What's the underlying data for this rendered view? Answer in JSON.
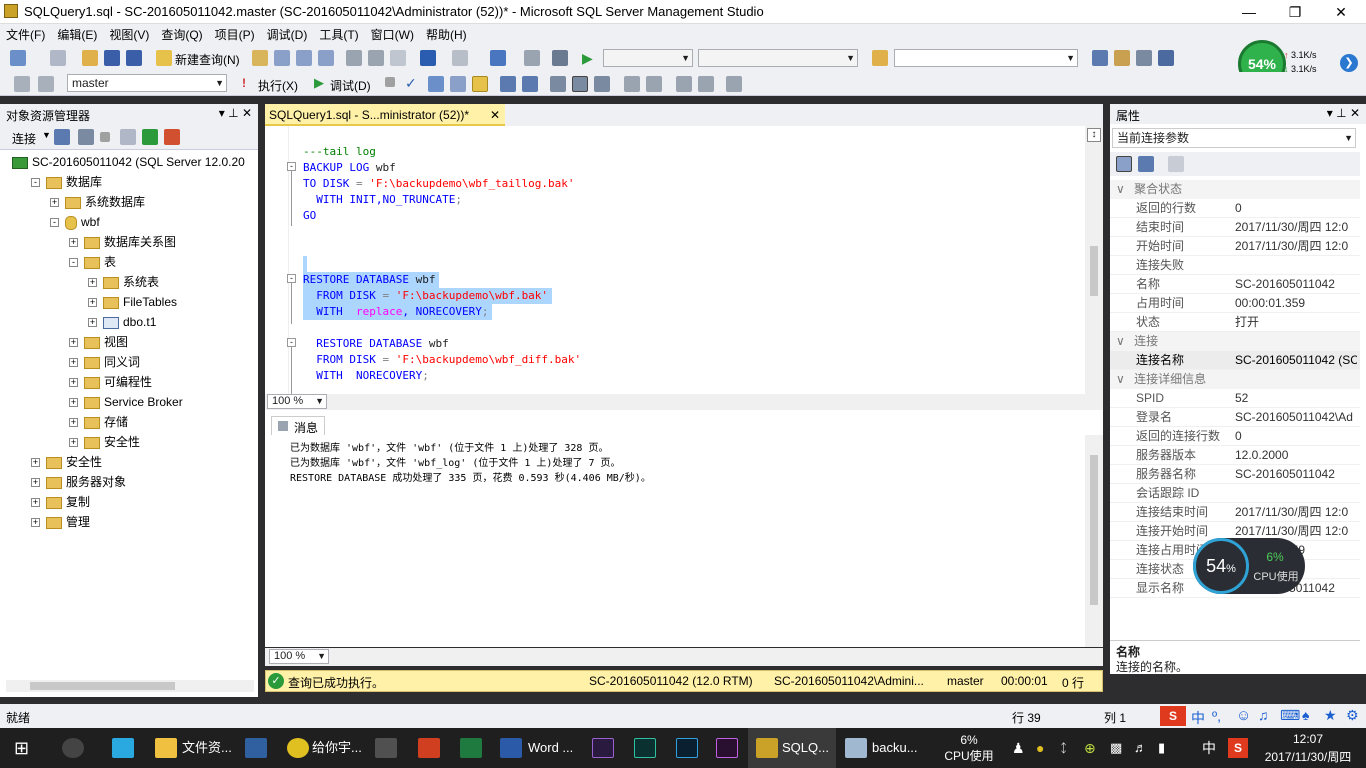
{
  "title": "SQLQuery1.sql - SC-201605011042.master (SC-201605011042\\Administrator (52))* - Microsoft SQL Server Management Studio",
  "menu": [
    "文件(F)",
    "编辑(E)",
    "视图(V)",
    "查询(Q)",
    "项目(P)",
    "调试(D)",
    "工具(T)",
    "窗口(W)",
    "帮助(H)"
  ],
  "toolbar": {
    "new_query": "新建查询(N)",
    "database": "master",
    "execute": "执行(X)",
    "debug": "调试(D)"
  },
  "gauge": {
    "percent": "54%",
    "up": "3.1K/s",
    "down": "3.1K/s"
  },
  "object_explorer": {
    "title": "对象资源管理器",
    "connect": "连接",
    "nodes": [
      {
        "label": "SC-201605011042 (SQL Server 12.0.20",
        "indent": 0
      },
      {
        "label": "数据库",
        "indent": 1
      },
      {
        "label": "系统数据库",
        "indent": 2
      },
      {
        "label": "wbf",
        "indent": 2
      },
      {
        "label": "数据库关系图",
        "indent": 3
      },
      {
        "label": "表",
        "indent": 3
      },
      {
        "label": "系统表",
        "indent": 4
      },
      {
        "label": "FileTables",
        "indent": 4
      },
      {
        "label": "dbo.t1",
        "indent": 4
      },
      {
        "label": "视图",
        "indent": 3
      },
      {
        "label": "同义词",
        "indent": 3
      },
      {
        "label": "可编程性",
        "indent": 3
      },
      {
        "label": "Service Broker",
        "indent": 3
      },
      {
        "label": "存储",
        "indent": 3
      },
      {
        "label": "安全性",
        "indent": 3
      },
      {
        "label": "安全性",
        "indent": 1
      },
      {
        "label": "服务器对象",
        "indent": 1
      },
      {
        "label": "复制",
        "indent": 1
      },
      {
        "label": "管理",
        "indent": 1
      }
    ]
  },
  "editor": {
    "tab": "SQLQuery1.sql - S...ministrator (52))*",
    "zoom": "100 %",
    "code": {
      "l1": "---tail log",
      "l2a": "BACKUP LOG",
      "l2b": " wbf",
      "l3a": "TO DISK",
      "l3b": " = ",
      "l3c": "'F:\\backupdemo\\wbf_taillog.bak'",
      "l4a": "  WITH INIT,NO_TRUNCATE",
      "l4b": ";",
      "l5": "GO",
      "l6a": "RESTORE DATABASE",
      "l6b": " wbf",
      "l7a": "  FROM DISK",
      "l7b": " = ",
      "l7c": "'F:\\backupdemo\\wbf.bak'",
      "l8a": "  WITH  ",
      "l8b": "replace",
      "l8c": ", NORECOVERY",
      "l8d": ";",
      "l9a": "  RESTORE DATABASE",
      "l9b": " wbf",
      "l10a": "  FROM DISK",
      "l10b": " = ",
      "l10c": "'F:\\backupdemo\\wbf_diff.bak'",
      "l11a": "  WITH  NORECOVERY",
      "l11b": ";"
    }
  },
  "messages": {
    "tab": "消息",
    "lines": [
      "已为数据库 'wbf'，文件 'wbf' (位于文件 1 上)处理了 328 页。",
      "已为数据库 'wbf'，文件 'wbf_log' (位于文件 1 上)处理了 7 页。",
      "RESTORE DATABASE 成功处理了 335 页，花费 0.593 秒(4.406 MB/秒)。"
    ],
    "zoom": "100 %"
  },
  "query_status": {
    "text": "查询已成功执行。",
    "server": "SC-201605011042 (12.0 RTM)",
    "user": "SC-201605011042\\Admini...",
    "db": "master",
    "time": "00:00:01",
    "rows": "0 行"
  },
  "properties": {
    "title": "属性",
    "selector": "当前连接参数",
    "cat1": "聚合状态",
    "rows1": [
      [
        "返回的行数",
        "0"
      ],
      [
        "结束时间",
        "2017/11/30/周四 12:0"
      ],
      [
        "开始时间",
        "2017/11/30/周四 12:0"
      ],
      [
        "连接失败",
        ""
      ],
      [
        "名称",
        "SC-201605011042"
      ],
      [
        "占用时间",
        "00:00:01.359"
      ],
      [
        "状态",
        "打开"
      ]
    ],
    "cat2": "连接",
    "rows2": [
      [
        "连接名称",
        "SC-201605011042 (SC"
      ]
    ],
    "cat3": "连接详细信息",
    "rows3": [
      [
        "SPID",
        "52"
      ],
      [
        "登录名",
        "SC-201605011042\\Ad"
      ],
      [
        "返回的连接行数",
        "0"
      ],
      [
        "服务器版本",
        "12.0.2000"
      ],
      [
        "服务器名称",
        "SC-201605011042"
      ],
      [
        "会话跟踪 ID",
        ""
      ],
      [
        "连接结束时间",
        "2017/11/30/周四 12:0"
      ],
      [
        "连接开始时间",
        "2017/11/30/周四 12:0"
      ],
      [
        "连接占用时间",
        "00:00:01.359"
      ],
      [
        "连接状态",
        "打开"
      ],
      [
        "显示名称",
        "SC-201605011042"
      ]
    ],
    "desc_title": "名称",
    "desc": "连接的名称。"
  },
  "cpu_widget": {
    "big": "54",
    "pct": "%",
    "small": "6%",
    "label": "CPU使用"
  },
  "statusbar": {
    "left": "就绪",
    "line": "行 39",
    "col": "列 1"
  },
  "taskbar": {
    "items": [
      "文件资...",
      "给你宇...",
      "Word ...",
      "SQLQ...",
      "backu..."
    ],
    "cpu": "6%",
    "cpu_label": "CPU使用",
    "time": "12:07",
    "date": "2017/11/30/周四",
    "ime": "中"
  }
}
